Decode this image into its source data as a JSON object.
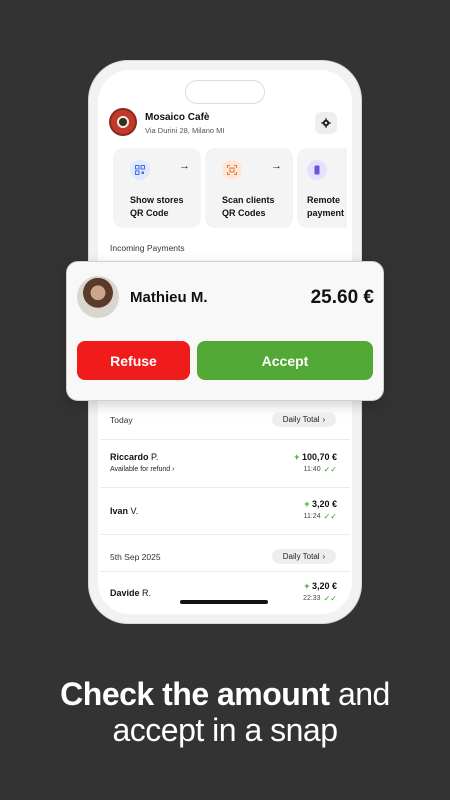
{
  "store": {
    "name": "Mosaico Cafè",
    "address": "Via Durini 28, Milano MI"
  },
  "actions": [
    {
      "label_line1": "Show stores",
      "label_line2": "QR Code",
      "icon": "qr-code-icon",
      "color": "#dfe9ff"
    },
    {
      "label_line1": "Scan clients",
      "label_line2": "QR Codes",
      "icon": "scan-icon",
      "color": "#ffe6d6"
    },
    {
      "label_line1": "Remote",
      "label_line2": "payment",
      "icon": "phone-icon",
      "color": "#e6e1ff"
    }
  ],
  "incoming_title": "Incoming Payments",
  "request": {
    "name": "Mathieu M.",
    "amount": "25.60 €",
    "refuse_label": "Refuse",
    "accept_label": "Accept"
  },
  "groups": [
    {
      "label": "Today",
      "total_label": "Daily Total",
      "transactions": [
        {
          "first": "Riccardo",
          "last": "P.",
          "sub": "Available for refund",
          "amount_sign": "+",
          "amount": "100,70 €",
          "time": "11:40"
        },
        {
          "first": "Ivan",
          "last": "V.",
          "sub": "",
          "amount_sign": "+",
          "amount": "3,20 €",
          "time": "11:24"
        }
      ]
    },
    {
      "label": "5th Sep 2025",
      "total_label": "Daily Total",
      "transactions": [
        {
          "first": "Davide",
          "last": "R.",
          "sub": "",
          "amount_sign": "+",
          "amount": "3,20 €",
          "time": "22:33"
        }
      ]
    }
  ],
  "headline": {
    "bold": "Check the amount",
    "rest1": " and",
    "line2": "accept in a snap"
  },
  "colors": {
    "background": "#333333",
    "refuse": "#f01c1c",
    "accept": "#52a935",
    "positive": "#3f9b2d"
  }
}
